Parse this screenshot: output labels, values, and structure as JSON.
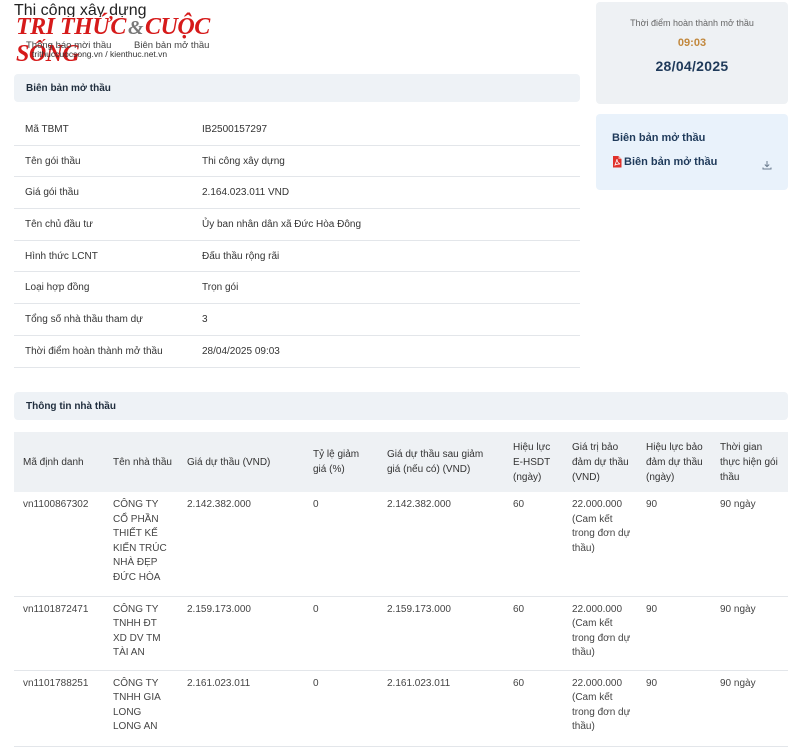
{
  "page": {
    "title": "Thi công xây dựng",
    "tabs": [
      "Thông báo mời thầu",
      "Biên bản mở thầu"
    ]
  },
  "brand": {
    "logo_part1": "TRI THỨC",
    "logo_amp": "&",
    "logo_part2": "CUỘC SỐNG",
    "sub": "trithuccuocsong.vn / kienthuc.net.vn"
  },
  "bid_minutes": {
    "section_title": "Biên bản mở thầu",
    "rows": [
      {
        "label": "Mã TBMT",
        "value": "IB2500157297"
      },
      {
        "label": "Tên gói thầu",
        "value": "Thi công xây dựng"
      },
      {
        "label": "Giá gói thầu",
        "value": "2.164.023.011 VND"
      },
      {
        "label": "Tên chủ đầu tư",
        "value": "Ủy ban nhân dân xã Đức Hòa Đông"
      },
      {
        "label": "Hình thức LCNT",
        "value": "Đấu thầu rộng rãi"
      },
      {
        "label": "Loại hợp đồng",
        "value": "Trọn gói"
      },
      {
        "label": "Tổng số nhà thầu tham dự",
        "value": "3"
      },
      {
        "label": "Thời điểm hoàn thành mở thầu",
        "value": "28/04/2025 09:03"
      }
    ]
  },
  "completion_card": {
    "label": "Thời điểm hoàn thành mở thầu",
    "time": "09:03",
    "date": "28/04/2025"
  },
  "document_card": {
    "title": "Biên bản mở thầu",
    "file_label": "Biên bản mở thầu",
    "file_icon": "pdf-icon",
    "action_icon": "download-icon"
  },
  "contractors": {
    "section_title": "Thông tin nhà thầu",
    "headers": [
      "Mã định danh",
      "Tên nhà thầu",
      "Giá dự thầu (VND)",
      "Tỷ lệ giảm giá (%)",
      "Giá dự thầu sau giảm giá (nếu có) (VND)",
      "Hiệu lực E-HSDT (ngày)",
      "Giá trị bảo đảm dự thầu (VND)",
      "Hiệu lực bảo đảm dự thầu (ngày)",
      "Thời gian thực hiện gói thầu"
    ],
    "rows": [
      [
        "vn1100867302",
        "CÔNG TY CỔ PHẦN THIẾT KẾ KIẾN TRÚC NHÀ ĐẸP ĐỨC HÒA",
        "2.142.382.000",
        "0",
        "2.142.382.000",
        "60",
        "22.000.000 (Cam kết trong đơn dự thầu)",
        "90",
        "90 ngày"
      ],
      [
        "vn1101872471",
        "CÔNG TY TNHH ĐT XD DV TM TÀI AN",
        "2.159.173.000",
        "0",
        "2.159.173.000",
        "60",
        "22.000.000 (Cam kết trong đơn dự thầu)",
        "90",
        "90 ngày"
      ],
      [
        "vn1101788251",
        "CÔNG TY TNHH GIA LONG LONG AN",
        "2.161.023.011",
        "0",
        "2.161.023.011",
        "60",
        "22.000.000 (Cam kết trong đơn dự thầu)",
        "90",
        "90 ngày"
      ]
    ]
  },
  "colors": {
    "accent_gold": "#c2883d",
    "navy": "#1f3a5a",
    "logo_red": "#d61a1a",
    "pdf_red": "#e0312b"
  }
}
